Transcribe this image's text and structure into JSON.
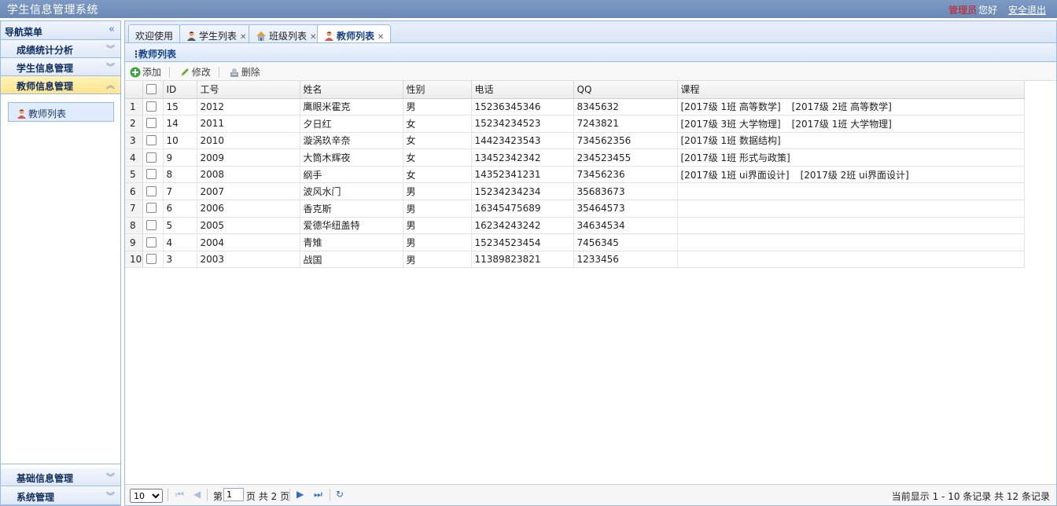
{
  "header": {
    "title": "学生信息管理系统",
    "admin": "管理员",
    "hello": "您好",
    "logout": "安全退出"
  },
  "nav": {
    "title": "导航菜单",
    "groups_top": [
      "成绩统计分析",
      "学生信息管理",
      "教师信息管理"
    ],
    "active_group": "教师信息管理",
    "link": "教师列表",
    "groups_bottom": [
      "基础信息管理",
      "系统管理"
    ]
  },
  "tabs": [
    {
      "label": "欢迎使用",
      "closable": false,
      "icon": ""
    },
    {
      "label": "学生列表",
      "closable": true,
      "icon": "student-icon"
    },
    {
      "label": "班级列表",
      "closable": true,
      "icon": "house-icon"
    },
    {
      "label": "教师列表",
      "closable": true,
      "icon": "teacher-icon",
      "active": true
    }
  ],
  "panel": {
    "title": "教师列表"
  },
  "toolbar": {
    "add": "添加",
    "edit": "修改",
    "delete": "删除"
  },
  "grid": {
    "columns": [
      "ID",
      "工号",
      "姓名",
      "性别",
      "电话",
      "QQ",
      "课程"
    ],
    "rows": [
      {
        "n": "1",
        "id": "15",
        "no": "2012",
        "name": "鹰眼米霍克",
        "sex": "男",
        "phone": "15236345346",
        "qq": "8345632",
        "courses": [
          "[2017级 1班 高等数学]",
          "[2017级 2班 高等数学]"
        ]
      },
      {
        "n": "2",
        "id": "14",
        "no": "2011",
        "name": "夕日红",
        "sex": "女",
        "phone": "15234234523",
        "qq": "7243821",
        "courses": [
          "[2017级 3班 大学物理]",
          "[2017级 1班 大学物理]"
        ]
      },
      {
        "n": "3",
        "id": "10",
        "no": "2010",
        "name": "漩涡玖辛奈",
        "sex": "女",
        "phone": "14423423543",
        "qq": "734562356",
        "courses": [
          "[2017级 1班 数据结构]"
        ]
      },
      {
        "n": "4",
        "id": "9",
        "no": "2009",
        "name": "大筒木辉夜",
        "sex": "女",
        "phone": "13452342342",
        "qq": "234523455",
        "courses": [
          "[2017级 1班 形式与政策]"
        ]
      },
      {
        "n": "5",
        "id": "8",
        "no": "2008",
        "name": "纲手",
        "sex": "女",
        "phone": "14352341231",
        "qq": "73456236",
        "courses": [
          "[2017级 1班 ui界面设计]",
          "[2017级 2班 ui界面设计]"
        ]
      },
      {
        "n": "6",
        "id": "7",
        "no": "2007",
        "name": "波风水门",
        "sex": "男",
        "phone": "15234234234",
        "qq": "35683673",
        "courses": []
      },
      {
        "n": "7",
        "id": "6",
        "no": "2006",
        "name": "香克斯",
        "sex": "男",
        "phone": "16345475689",
        "qq": "35464573",
        "courses": []
      },
      {
        "n": "8",
        "id": "5",
        "no": "2005",
        "name": "爱德华纽盖特",
        "sex": "男",
        "phone": "16234243242",
        "qq": "34634534",
        "courses": []
      },
      {
        "n": "9",
        "id": "4",
        "no": "2004",
        "name": "青雉",
        "sex": "男",
        "phone": "15234523454",
        "qq": "7456345",
        "courses": []
      },
      {
        "n": "10",
        "id": "3",
        "no": "2003",
        "name": "战国",
        "sex": "男",
        "phone": "11389823821",
        "qq": "1233456",
        "courses": []
      }
    ]
  },
  "pager": {
    "page_size": "10",
    "page_prefix": "第",
    "page_value": "1",
    "page_suffix": "页 共 2 页",
    "info": "当前显示 1 - 10 条记录 共 12 条记录"
  },
  "colors": {
    "header_bg": "#6a89b6",
    "admin_red": "#d0171b",
    "active_group": "#ffe48d",
    "border": "#99bbe8"
  }
}
